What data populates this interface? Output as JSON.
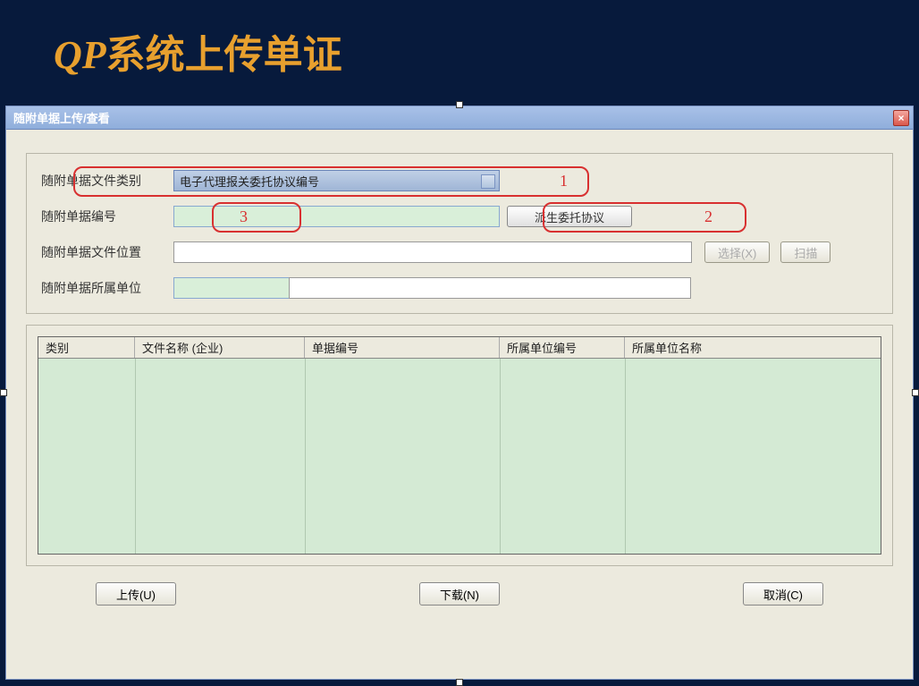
{
  "slide": {
    "title_qp": "QP",
    "title_rest": "系统上传单证"
  },
  "window": {
    "title": "随附单据上传/查看",
    "close": "×"
  },
  "form": {
    "file_type_label": "随附单据文件类别",
    "file_type_value": "电子代理报关委托协议编号",
    "doc_no_label": "随附单据编号",
    "doc_no_value": "",
    "derive_button": "派生委托协议",
    "file_loc_label": "随附单据文件位置",
    "file_loc_value": "",
    "select_button": "选择(X)",
    "scan_button": "扫描",
    "unit_label": "随附单据所属单位",
    "unit_code_value": "",
    "unit_name_value": ""
  },
  "annotations": {
    "num1": "1",
    "num2": "2",
    "num3": "3"
  },
  "table": {
    "headers": {
      "col1": "类别",
      "col2": "文件名称 (企业)",
      "col3": "单据编号",
      "col4": "所属单位编号",
      "col5": "所属单位名称"
    }
  },
  "buttons": {
    "upload": "上传(U)",
    "download": "下载(N)",
    "cancel": "取消(C)"
  }
}
